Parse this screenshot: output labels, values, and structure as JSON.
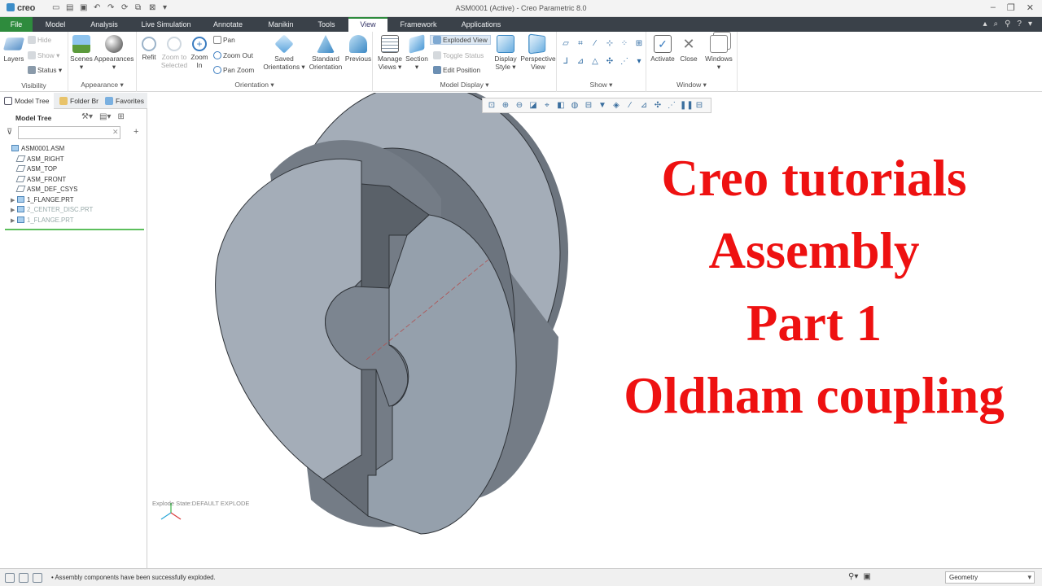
{
  "app": {
    "logo": "creo",
    "window_title": "ASM0001 (Active) - Creo Parametric 8.0"
  },
  "tabs": [
    {
      "label": "File"
    },
    {
      "label": "Model"
    },
    {
      "label": "Analysis"
    },
    {
      "label": "Live Simulation"
    },
    {
      "label": "Annotate"
    },
    {
      "label": "Manikin"
    },
    {
      "label": "Tools"
    },
    {
      "label": "View"
    },
    {
      "label": "Framework"
    },
    {
      "label": "Applications"
    }
  ],
  "ribbon": {
    "visibility": {
      "label": "Visibility",
      "layers": "Layers",
      "hide": "Hide",
      "show": "Show",
      "status": "Status"
    },
    "appearance": {
      "label": "Appearance",
      "scenes": "Scenes",
      "appearances": "Appearances"
    },
    "orientation": {
      "label": "Orientation",
      "refit": "Refit",
      "zoom_selected_1": "Zoom to",
      "zoom_selected_2": "Selected",
      "zoom_in_1": "Zoom",
      "zoom_in_2": "In",
      "pan": "Pan",
      "zoom_out": "Zoom Out",
      "pan_zoom": "Pan Zoom",
      "saved_1": "Saved",
      "saved_2": "Orientations",
      "standard_1": "Standard",
      "standard_2": "Orientation",
      "previous": "Previous"
    },
    "model_display": {
      "label": "Model Display",
      "manage_1": "Manage",
      "manage_2": "Views",
      "section": "Section",
      "exploded_view": "Exploded View",
      "toggle_status": "Toggle Status",
      "edit_position": "Edit Position",
      "display_style_1": "Display",
      "display_style_2": "Style",
      "perspective_1": "Perspective",
      "perspective_2": "View"
    },
    "show": {
      "label": "Show"
    },
    "window": {
      "label": "Window",
      "activate": "Activate",
      "close": "Close",
      "windows": "Windows"
    }
  },
  "panel": {
    "tabs": [
      "Model Tree",
      "Folder Br",
      "Favorites"
    ],
    "header": "Model Tree",
    "filter_placeholder": "",
    "items": [
      {
        "label": "ASM0001.ASM",
        "level": 0,
        "grey": false,
        "expand": false
      },
      {
        "label": "ASM_RIGHT",
        "level": 1,
        "grey": false,
        "expand": false
      },
      {
        "label": "ASM_TOP",
        "level": 1,
        "grey": false,
        "expand": false
      },
      {
        "label": "ASM_FRONT",
        "level": 1,
        "grey": false,
        "expand": false
      },
      {
        "label": "ASM_DEF_CSYS",
        "level": 1,
        "grey": false,
        "expand": false
      },
      {
        "label": "1_FLANGE.PRT",
        "level": 1,
        "grey": false,
        "expand": true
      },
      {
        "label": "2_CENTER_DISC.PRT",
        "level": 1,
        "grey": true,
        "expand": true
      },
      {
        "label": "1_FLANGE.PRT",
        "level": 1,
        "grey": true,
        "expand": true
      }
    ]
  },
  "viewport": {
    "headline": [
      "Creo tutorials",
      "Assembly",
      "Part 1",
      "Oldham coupling"
    ],
    "headline_color": "#ee1111",
    "explode_state": "Explode State:DEFAULT EXPLODE"
  },
  "statusbar": {
    "message": "• Assembly components have been successfully exploded.",
    "filter": "Geometry"
  },
  "colors": {
    "accent": "#2e8b3d",
    "tabbar": "#3a4149",
    "model_face": "#a4adb8",
    "model_side": "#6c747e"
  }
}
